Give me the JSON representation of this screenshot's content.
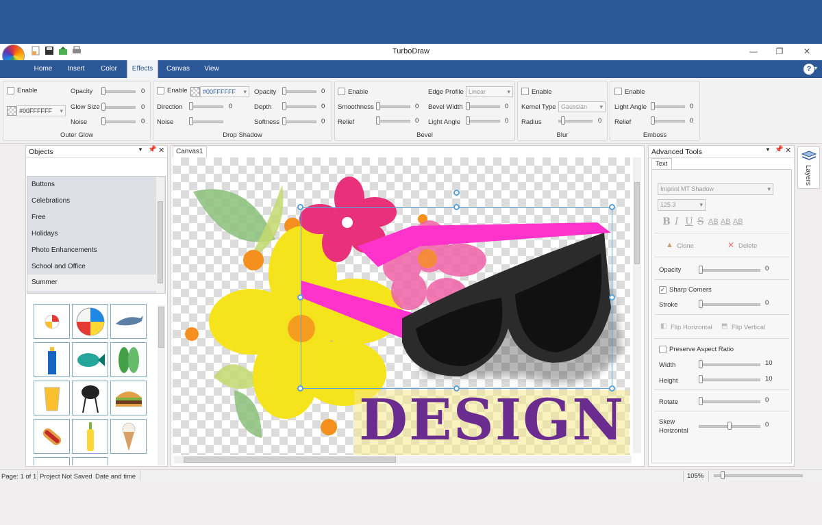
{
  "app": {
    "title": "TurboDraw"
  },
  "tabs": [
    "Home",
    "Insert",
    "Color",
    "Effects",
    "Canvas",
    "View"
  ],
  "active_tab": "Effects",
  "ribbon": {
    "outer_glow": {
      "title": "Outer Glow",
      "enable": "Enable",
      "color": "#00FFFFFF",
      "opacity": "Opacity",
      "glow_size": "Glow Size",
      "noise": "Noise",
      "v_opacity": "0",
      "v_glow": "0",
      "v_noise": "0"
    },
    "drop_shadow": {
      "title": "Drop Shadow",
      "enable": "Enable",
      "color": "#00FFFFFF",
      "direction": "Direction",
      "noise": "Noise",
      "opacity": "Opacity",
      "depth": "Depth",
      "softness": "Softness",
      "v_direction": "0",
      "v_opacity": "0",
      "v_depth": "0",
      "v_softness": "0"
    },
    "bevel": {
      "title": "Bevel",
      "enable": "Enable",
      "smoothness": "Smoothness",
      "relief": "Relief",
      "edge_profile": "Edge Profile",
      "edge_value": "Linear",
      "bevel_width": "Bevel Width",
      "light_angle": "Light Angle",
      "v_smooth": "0",
      "v_relief": "0",
      "v_width": "0",
      "v_angle": "0"
    },
    "blur": {
      "title": "Blur",
      "enable": "Enable",
      "kernel_type": "Kernel Type",
      "kernel_value": "Gaussian",
      "radius": "Radius",
      "v_radius": "0"
    },
    "emboss": {
      "title": "Emboss",
      "enable": "Enable",
      "light_angle": "Light Angle",
      "relief": "Relief",
      "v_angle": "0",
      "v_relief": "0"
    }
  },
  "objects_panel": {
    "title": "Objects",
    "categories": [
      "Buttons",
      "Celebrations",
      "Free",
      "Holidays",
      "Photo Enhancements",
      "School and Office",
      "Summer"
    ],
    "selected": "Summer"
  },
  "canvas": {
    "tab": "Canvas1",
    "design_text": "DESIGN"
  },
  "advanced_tools": {
    "title": "Advanced Tools",
    "tab": "Text",
    "font": "Imprint MT Shadow",
    "size": "125.3",
    "style_buttons": [
      "B",
      "I",
      "U",
      "S",
      "AB",
      "AB",
      "AB"
    ],
    "clone": "Clone",
    "delete": "Delete",
    "opacity": "Opacity",
    "v_opacity": "0",
    "sharp_corners": "Sharp Corners",
    "stroke": "Stroke",
    "v_stroke": "0",
    "flip_h": "Flip Horizontal",
    "flip_v": "Flip Vertical",
    "preserve": "Preserve Aspect Ratio",
    "width": "Width",
    "v_width": "10",
    "height": "Height",
    "v_height": "10",
    "rotate": "Rotate",
    "v_rotate": "0",
    "skew": "Skew\nHorizontal",
    "v_skew": "0"
  },
  "side_tab": "Layers",
  "status": {
    "page": "Page: 1 of 1",
    "saved": "Project Not Saved",
    "date": "Date and time",
    "zoom": "105%"
  },
  "colors": {
    "brand": "#2b5797",
    "accent_magenta": "#ff33cc",
    "flower_yellow": "#f5e31c",
    "flower_pink": "#e8317a",
    "design_purple": "#6a2d8f"
  }
}
